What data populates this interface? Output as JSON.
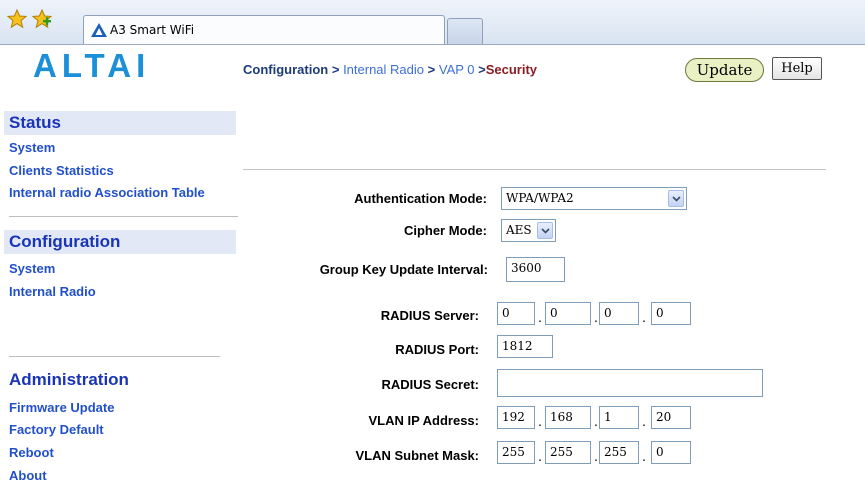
{
  "browser": {
    "tab_title": "A3 Smart WiFi"
  },
  "brand": {
    "logo_text": "ALTAI",
    "logo_color": "#1b8fd8"
  },
  "breadcrumb": {
    "configuration": "Configuration",
    "sep1": ">",
    "internal_radio": "Internal Radio",
    "sep2": ">",
    "vap": "VAP 0",
    "sep3": ">",
    "current": "Security"
  },
  "toolbar": {
    "update_label": "Update",
    "help_label": "Help"
  },
  "sidebar": {
    "status": {
      "title": "Status",
      "items": [
        "System",
        "Clients Statistics",
        "Internal radio Association Table"
      ]
    },
    "configuration": {
      "title": "Configuration",
      "items": [
        "System",
        "Internal Radio"
      ]
    },
    "administration": {
      "title": "Administration",
      "items": [
        "Firmware Update",
        "Factory Default",
        "Reboot",
        "About"
      ]
    }
  },
  "form": {
    "auth_mode": {
      "label": "Authentication Mode:",
      "value": "WPA/WPA2"
    },
    "cipher_mode": {
      "label": "Cipher Mode:",
      "value": "AES"
    },
    "group_key": {
      "label": "Group Key Update Interval:",
      "value": "3600"
    },
    "radius_server": {
      "label": "RADIUS Server:",
      "octets": [
        "0",
        "0",
        "0",
        "0"
      ]
    },
    "radius_port": {
      "label": "RADIUS Port:",
      "value": "1812"
    },
    "radius_secret": {
      "label": "RADIUS Secret:",
      "value": ""
    },
    "vlan_ip": {
      "label": "VLAN IP Address:",
      "octets": [
        "192",
        "168",
        "1",
        "20"
      ]
    },
    "vlan_mask": {
      "label": "VLAN Subnet Mask:",
      "octets": [
        "255",
        "255",
        "255",
        "0"
      ]
    },
    "octet_separator": "."
  }
}
